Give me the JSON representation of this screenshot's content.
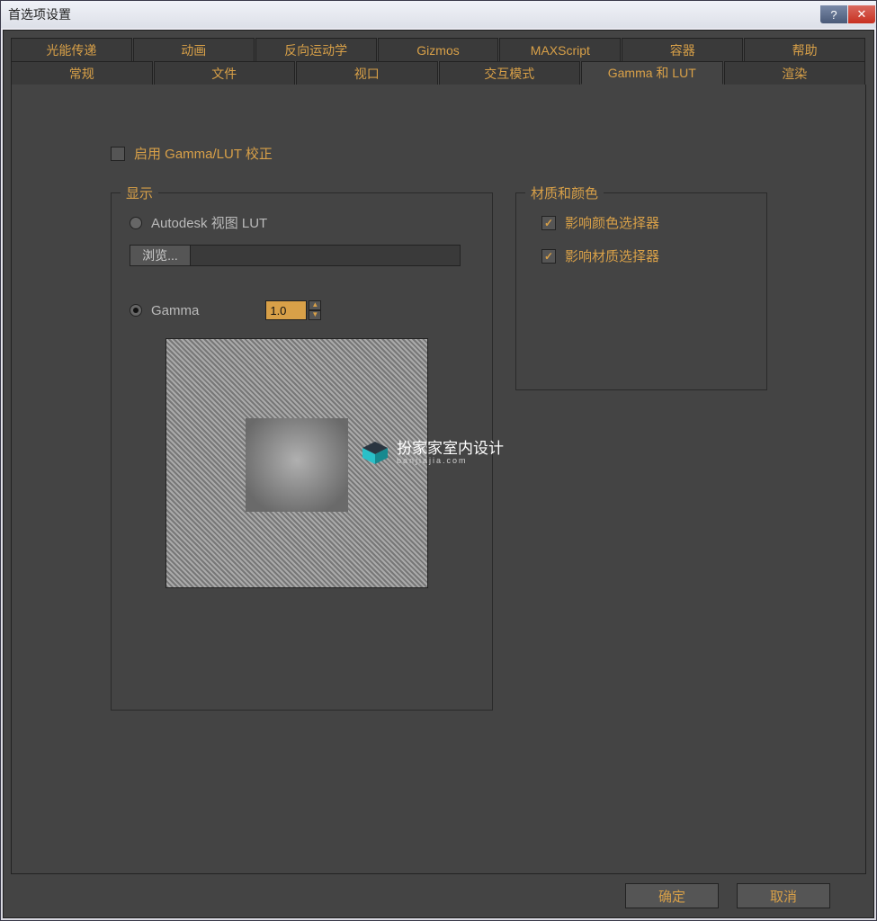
{
  "window": {
    "title": "首选项设置"
  },
  "titlebar": {
    "help": "?",
    "close": "✕"
  },
  "tabs_row1": [
    "光能传递",
    "动画",
    "反向运动学",
    "Gizmos",
    "MAXScript",
    "容器",
    "帮助"
  ],
  "tabs_row2": [
    "常规",
    "文件",
    "视口",
    "交互模式",
    "Gamma 和 LUT",
    "渲染"
  ],
  "active_tab": "Gamma 和 LUT",
  "enable": {
    "label": "启用 Gamma/LUT 校正",
    "checked": false
  },
  "display_group": {
    "title": "显示",
    "radio_lut": {
      "label": "Autodesk 视图 LUT",
      "selected": false
    },
    "browse_btn": "浏览...",
    "path_value": "",
    "radio_gamma": {
      "label": "Gamma",
      "selected": true
    },
    "gamma_value": "1.0"
  },
  "colors_group": {
    "title": "材质和颜色",
    "affect_color": {
      "label": "影响颜色选择器",
      "checked": true
    },
    "affect_material": {
      "label": "影响材质选择器",
      "checked": true
    }
  },
  "footer": {
    "ok": "确定",
    "cancel": "取消"
  },
  "watermark": {
    "text": "扮家家室内设计",
    "sub": "banjiajia.com"
  }
}
